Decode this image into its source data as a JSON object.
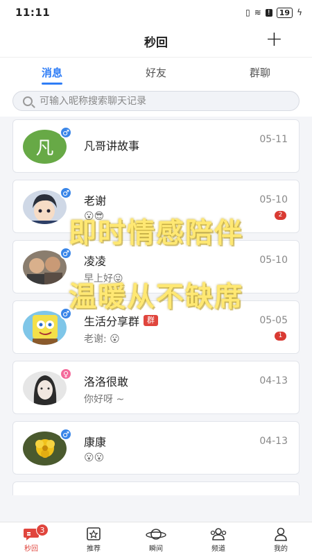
{
  "status": {
    "time": "11:11",
    "battery": "19"
  },
  "header": {
    "title": "秒回",
    "add_label": "+"
  },
  "tabs": [
    {
      "label": "消息",
      "active": true
    },
    {
      "label": "好友",
      "active": false
    },
    {
      "label": "群聊",
      "active": false
    }
  ],
  "search": {
    "placeholder": "可输入昵称搜索聊天记录"
  },
  "conversations": [
    {
      "name": "凡哥讲故事",
      "avatar_letter": "凡",
      "gender": "male",
      "date": "05-11",
      "preview": "",
      "badge": ""
    },
    {
      "name": "老谢",
      "gender": "male",
      "date": "05-10",
      "preview": "😮😎",
      "badge": "2"
    },
    {
      "name": "凌凌",
      "gender": "male",
      "date": "05-10",
      "preview": "早上好😜",
      "badge": ""
    },
    {
      "name": "生活分享群",
      "tag": "群",
      "gender": "male",
      "date": "05-05",
      "preview": "老谢: 😮",
      "badge": "1"
    },
    {
      "name": "洛洛很敢",
      "gender": "female",
      "date": "04-13",
      "preview": "你好呀 ~",
      "badge": ""
    },
    {
      "name": "康康",
      "gender": "male",
      "date": "04-13",
      "preview": "😮😮",
      "badge": ""
    }
  ],
  "overlay": {
    "line1": "即时情感陪伴",
    "line2": "温暖从不缺席"
  },
  "bottom_nav": [
    {
      "label": "秒回",
      "icon": "chat-icon",
      "active": true,
      "badge": "3"
    },
    {
      "label": "推荐",
      "icon": "star-icon",
      "active": false
    },
    {
      "label": "瞬间",
      "icon": "planet-icon",
      "active": false
    },
    {
      "label": "频道",
      "icon": "people-icon",
      "active": false
    },
    {
      "label": "我的",
      "icon": "person-icon",
      "active": false
    }
  ],
  "colors": {
    "accent": "#2f7df6",
    "badge": "#d93a32",
    "nav_active": "#e0453d",
    "avatar_green": "#67a946"
  }
}
